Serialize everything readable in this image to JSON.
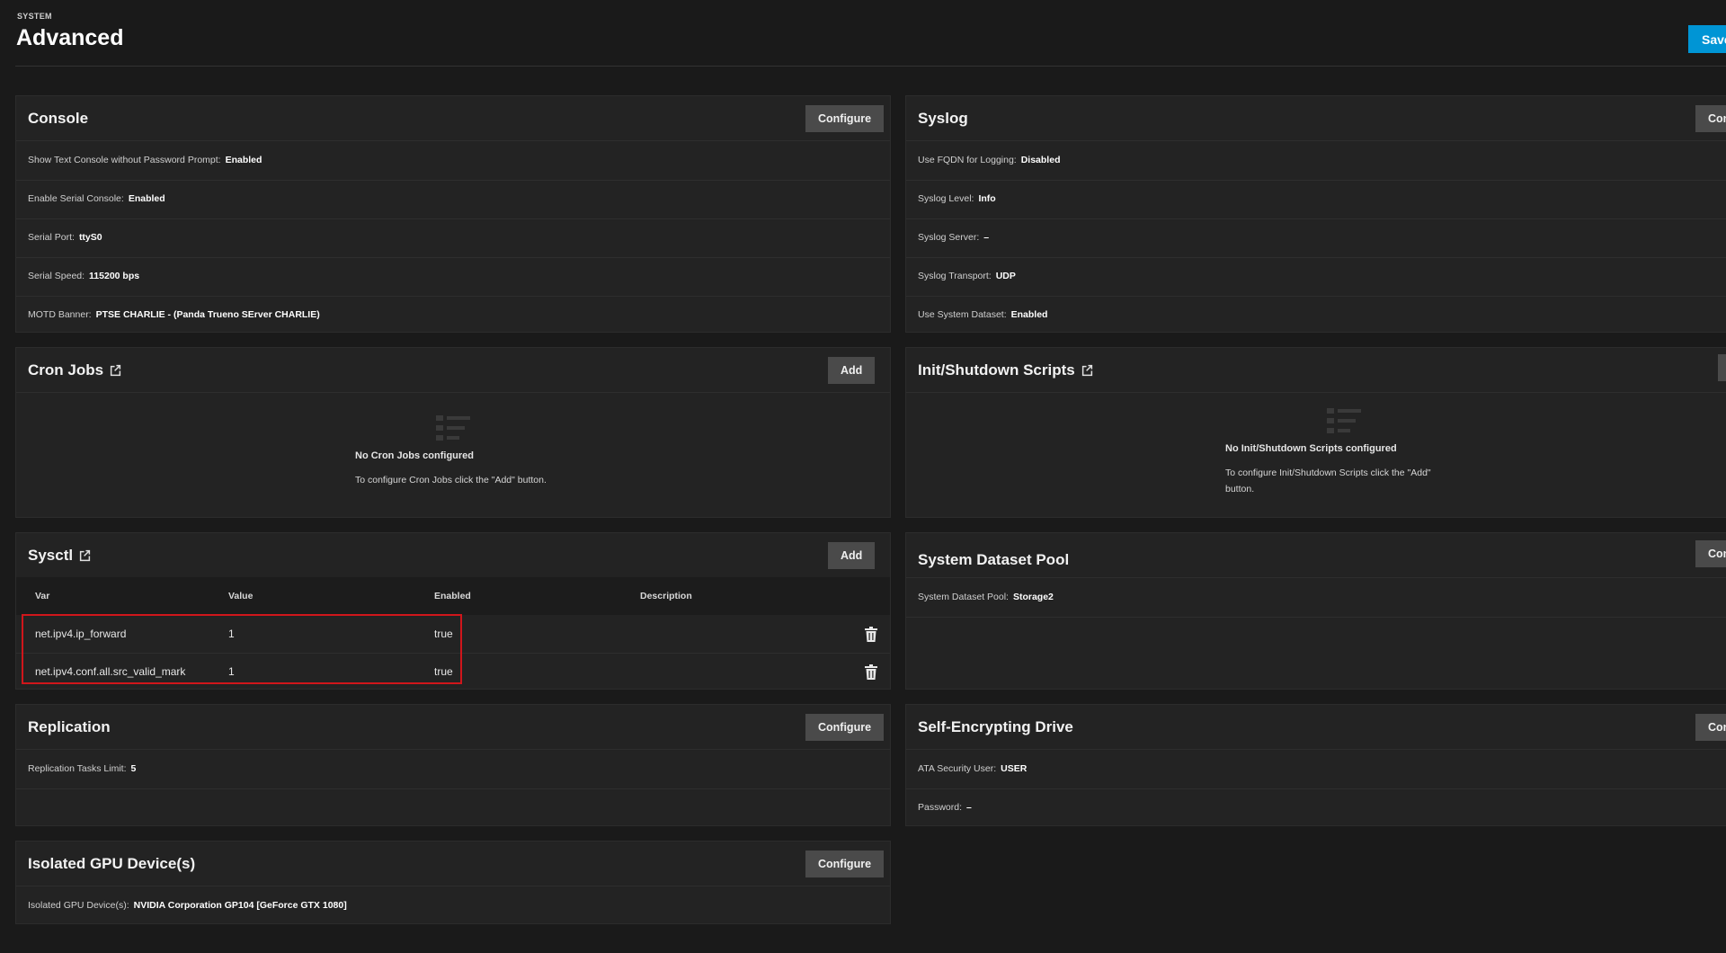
{
  "header": {
    "eyebrow": "SYSTEM",
    "title": "Advanced",
    "save_label": "Save"
  },
  "cards": {
    "console": {
      "title": "Console",
      "button": "Configure",
      "rows": [
        {
          "label": "Show Text Console without Password Prompt:",
          "value": "Enabled"
        },
        {
          "label": "Enable Serial Console:",
          "value": "Enabled"
        },
        {
          "label": "Serial Port:",
          "value": "ttyS0"
        },
        {
          "label": "Serial Speed:",
          "value": "115200 bps"
        },
        {
          "label": "MOTD Banner:",
          "value": "PTSE CHARLIE - (Panda Trueno SErver CHARLIE)"
        }
      ]
    },
    "syslog": {
      "title": "Syslog",
      "button": "Con",
      "rows": [
        {
          "label": "Use FQDN for Logging:",
          "value": "Disabled"
        },
        {
          "label": "Syslog Level:",
          "value": "Info"
        },
        {
          "label": "Syslog Server:",
          "value": "–"
        },
        {
          "label": "Syslog Transport:",
          "value": "UDP"
        },
        {
          "label": "Use System Dataset:",
          "value": "Enabled"
        }
      ]
    },
    "cron": {
      "title": "Cron Jobs",
      "button": "Add",
      "empty_title": "No Cron Jobs configured",
      "empty_desc": "To configure Cron Jobs click the \"Add\" button."
    },
    "init": {
      "title": "Init/Shutdown Scripts",
      "empty_title": "No Init/Shutdown Scripts configured",
      "empty_desc_1": "To configure Init/Shutdown Scripts click the \"Add\"",
      "empty_desc_2": "button."
    },
    "sysctl": {
      "title": "Sysctl",
      "button": "Add",
      "columns": {
        "var": "Var",
        "value": "Value",
        "enabled": "Enabled",
        "description": "Description"
      },
      "rows": [
        {
          "var": "net.ipv4.ip_forward",
          "value": "1",
          "enabled": "true",
          "description": ""
        },
        {
          "var": "net.ipv4.conf.all.src_valid_mark",
          "value": "1",
          "enabled": "true",
          "description": ""
        }
      ]
    },
    "dataset": {
      "title": "System Dataset Pool",
      "button": "Con",
      "rows": [
        {
          "label": "System Dataset Pool:",
          "value": "Storage2"
        }
      ]
    },
    "replication": {
      "title": "Replication",
      "button": "Configure",
      "rows": [
        {
          "label": "Replication Tasks Limit:",
          "value": "5"
        }
      ]
    },
    "sed": {
      "title": "Self-Encrypting Drive",
      "button": "Con",
      "rows": [
        {
          "label": "ATA Security User:",
          "value": "USER"
        },
        {
          "label": "Password:",
          "value": "–"
        }
      ]
    },
    "gpu": {
      "title": "Isolated GPU Device(s)",
      "button": "Configure",
      "rows": [
        {
          "label": "Isolated GPU Device(s):",
          "value": "NVIDIA Corporation GP104 [GeForce GTX 1080]"
        }
      ]
    }
  },
  "colors": {
    "accent": "#0095d5",
    "highlight": "#d0161b",
    "background": "#1a1a1a",
    "card": "#232323"
  },
  "icons": {
    "external_link": "open-in-new-icon",
    "delete": "trash-icon",
    "empty_state": "list-placeholder-icon"
  }
}
